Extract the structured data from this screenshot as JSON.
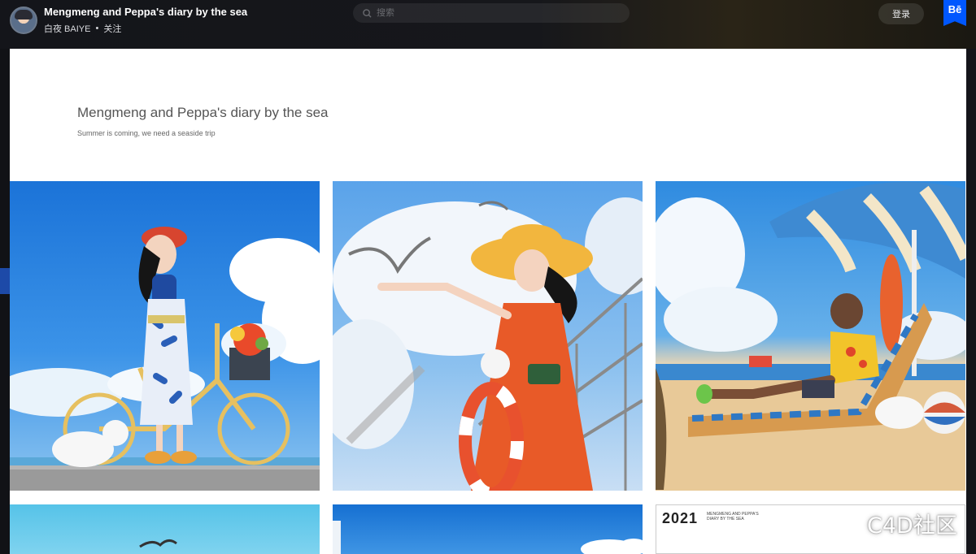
{
  "header": {
    "project_title": "Mengmeng and Peppa's diary by the sea",
    "owner_name": "白夜 BAIYE",
    "separator": "•",
    "follow_label": "关注",
    "search_placeholder": "搜索",
    "login_label": "登录",
    "brand_badge": "Bē"
  },
  "hero": {
    "title": "Mengmeng and Peppa's diary by the sea",
    "subtitle": "Summer is coming, we need a seaside trip"
  },
  "gallery": {
    "tile6_year": "2021",
    "tile6_caption": "MENGMENG AND PEPPA'S DIARY BY THE SEA"
  },
  "watermark": "C4D社区",
  "colors": {
    "accent": "#0057ff",
    "topbar": "#16171b",
    "canvas": "#ffffff"
  }
}
